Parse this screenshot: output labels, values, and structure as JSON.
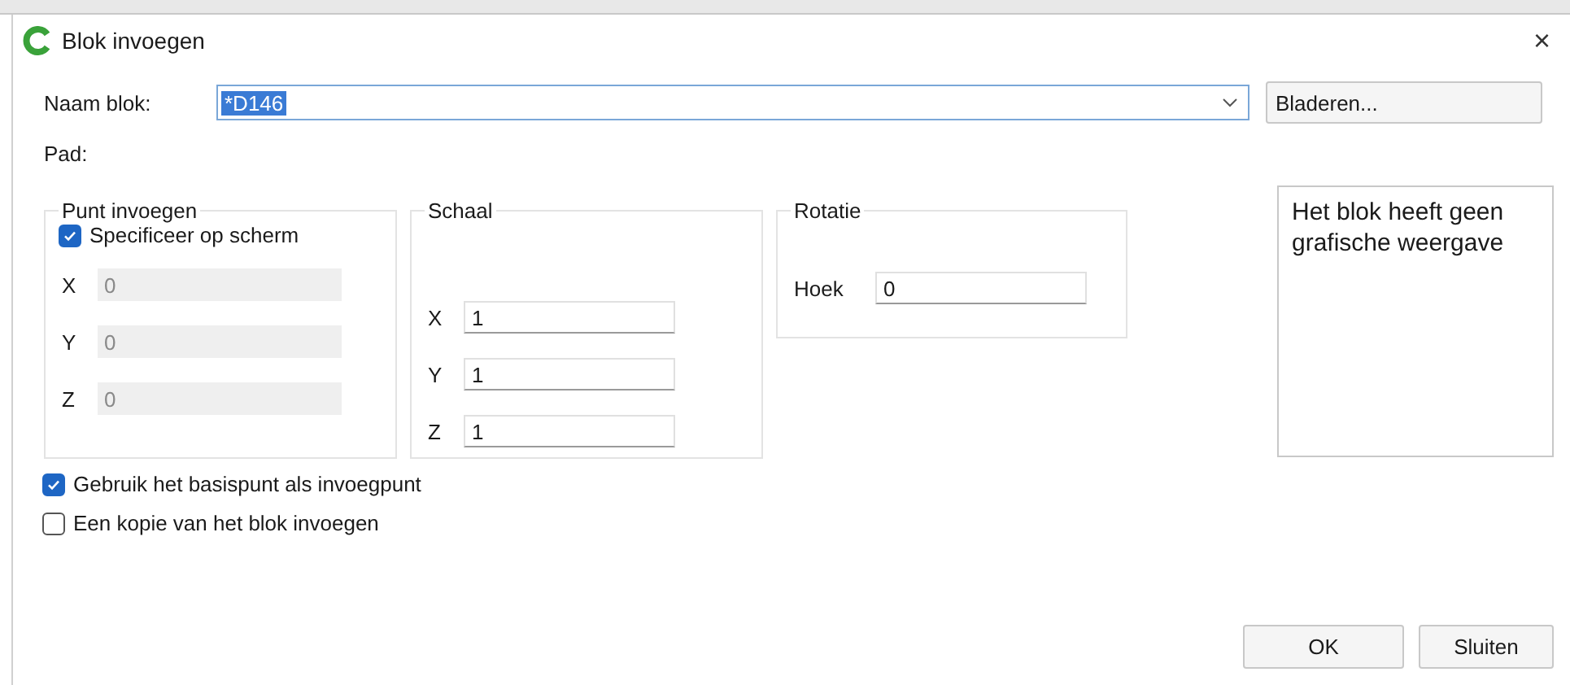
{
  "window": {
    "title": "Blok invoegen",
    "close": "×"
  },
  "name_row": {
    "label": "Naam blok:",
    "value": "*D146",
    "selected_text": true,
    "browse_button": "Bladeren..."
  },
  "path": {
    "label": "Pad:"
  },
  "insert_point": {
    "title": "Punt invoegen",
    "specify_on_screen": {
      "label": "Specificeer op scherm",
      "checked": true
    },
    "fields": [
      {
        "label": "X",
        "value": "0",
        "disabled": true
      },
      {
        "label": "Y",
        "value": "0",
        "disabled": true
      },
      {
        "label": "Z",
        "value": "0",
        "disabled": true
      }
    ]
  },
  "scale": {
    "title": "Schaal",
    "fields": [
      {
        "label": "X",
        "value": "1",
        "disabled": false
      },
      {
        "label": "Y",
        "value": "1",
        "disabled": false
      },
      {
        "label": "Z",
        "value": "1",
        "disabled": false
      }
    ]
  },
  "rotation": {
    "title": "Rotatie",
    "angle": {
      "label": "Hoek",
      "value": "0"
    }
  },
  "preview": {
    "text": "Het blok heeft geen grafische weergave"
  },
  "options": [
    {
      "label": "Gebruik het basispunt als invoegpunt",
      "checked": true
    },
    {
      "label": "Een kopie van het blok invoegen",
      "checked": false
    }
  ],
  "buttons": [
    "OK",
    "Sluiten"
  ]
}
